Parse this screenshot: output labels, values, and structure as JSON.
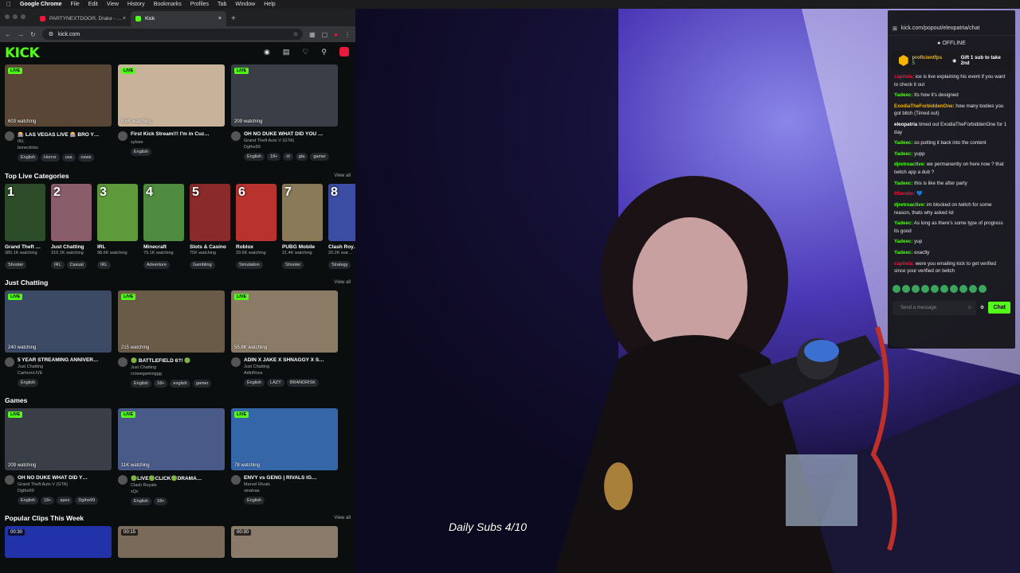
{
  "menubar": {
    "apple": "",
    "app": "Google Chrome",
    "items": [
      "File",
      "Edit",
      "View",
      "History",
      "Bookmarks",
      "Profiles",
      "Tab",
      "Window",
      "Help"
    ]
  },
  "tabs": [
    {
      "title": "PARTYNEXTDOOR, Drake - …",
      "active": false
    },
    {
      "title": "Kick",
      "active": true
    }
  ],
  "toolbar": {
    "url": "kick.com"
  },
  "kick": {
    "logo": "KICK"
  },
  "featured": [
    {
      "watching": "603 watching",
      "title": "🎰 LAS VEGAS LIVE 🎰 BRO Y…",
      "sub": "IRL",
      "channel": "boneclinks",
      "tags": [
        "English",
        "Horror",
        "usa",
        "news"
      ],
      "bg": "#5a4636"
    },
    {
      "watching": "5.6K watching",
      "title": "First Kick Stream!!! I'm in Cuz…",
      "sub": "",
      "channel": "sylvee",
      "tags": [
        "English"
      ],
      "bg": "#c9b29a"
    },
    {
      "watching": "209 watching",
      "title": "OH NO DUKE WHAT DID YOU …",
      "sub": "Grand Theft Auto V (GTA)",
      "channel": "Dgthe99",
      "tags": [
        "English",
        "18+",
        "irl",
        "gta",
        "gamer"
      ],
      "bg": "#3a3e46"
    }
  ],
  "categories_section": {
    "title": "Top Live Categories",
    "view_all": "View all"
  },
  "categories": [
    {
      "rank": "1",
      "name": "Grand Theft …",
      "viewers": "380.1K watching",
      "tag": "Shooter",
      "bg": "#2d4d2a"
    },
    {
      "rank": "2",
      "name": "Just Chatting",
      "viewers": "310.1K watching",
      "tag": "IRL",
      "tag2": "Casual",
      "bg": "#8a5d6a"
    },
    {
      "rank": "3",
      "name": "IRL",
      "viewers": "98.6K watching",
      "tag": "IRL",
      "bg": "#5d9a3a"
    },
    {
      "rank": "4",
      "name": "Minecraft",
      "viewers": "79.1K watching",
      "tag": "Adventure",
      "bg": "#4f8c3f"
    },
    {
      "rank": "5",
      "name": "Slots & Casino",
      "viewers": "75K watching",
      "tag": "Gambling",
      "bg": "#8a2a2a"
    },
    {
      "rank": "6",
      "name": "Roblox",
      "viewers": "29.6K watching",
      "tag": "Simulation",
      "bg": "#b8332e"
    },
    {
      "rank": "7",
      "name": "PUBG Mobile",
      "viewers": "21.4K watching",
      "tag": "Shooter",
      "bg": "#8a7a5a"
    },
    {
      "rank": "8",
      "name": "Clash Roy…",
      "viewers": "20.2K wat…",
      "tag": "Strategy",
      "bg": "#3b4da5"
    }
  ],
  "just_chatting_section": {
    "title": "Just Chatting",
    "view_all": "View all"
  },
  "just_chatting": [
    {
      "watching": "240 watching",
      "title": "5 YEAR STREAMING ANNIVER…",
      "sub": "Just Chatting",
      "channel": "CartoonLIVE",
      "tags": [
        "English"
      ],
      "bg": "#3c4a66"
    },
    {
      "watching": "215 watching",
      "title": "🟢 BATTLEFIELD 6?! 🟢",
      "sub": "Just Chatting",
      "channel": "crowegaminggg",
      "tags": [
        "English",
        "18+",
        "english",
        "gamer"
      ],
      "bg": "#6a5a48"
    },
    {
      "watching": "55.8K watching",
      "title": "ADIN X JAKE X SHNAGGY X S…",
      "sub": "Just Chatting",
      "channel": "AdinRoss",
      "tags": [
        "English",
        "LAZY",
        "BRANDRISK"
      ],
      "bg": "#8a7a66"
    }
  ],
  "games_section": {
    "title": "Games"
  },
  "games": [
    {
      "watching": "209 watching",
      "title": "OH NO DUKE WHAT DID Y…",
      "sub": "Grand Theft Auto V (GTA)",
      "channel": "Dgthe99",
      "tags": [
        "English",
        "18+",
        "apex",
        "Dgthe99"
      ],
      "bg": "#3a3e46"
    },
    {
      "watching": "11K watching",
      "title": "🟢LIVE🟢CLICK🟢DRAMA…",
      "sub": "Clash Royale",
      "channel": "xQc",
      "tags": [
        "English",
        "18+"
      ],
      "bg": "#4a5a88"
    },
    {
      "watching": "78 watching",
      "title": "ENVY vs GENG | RIVALS IG…",
      "sub": "Marvel Rivals",
      "channel": "sinatraa",
      "tags": [
        "English"
      ],
      "bg": "#3566a8"
    }
  ],
  "clips_section": {
    "title": "Popular Clips This Week",
    "view_all": "View all"
  },
  "clips": [
    {
      "duration": "00:30",
      "bg": "#2233aa"
    },
    {
      "duration": "00:15",
      "bg": "#7a6a5a"
    },
    {
      "duration": "00:30",
      "bg": "#8a7a6a"
    }
  ],
  "stream": {
    "caption": "Daily Subs 4/10"
  },
  "chat": {
    "url": "kick.com/popout/eleopatria/chat",
    "status": "OFFLINE",
    "pinned_user": "proficientfps",
    "pinned_count": "5",
    "pinned_text": "Gift 1 sub to take 2nd",
    "messages": [
      {
        "user": "capitela:",
        "color": "#e8193c",
        "text": "ice is live explaining his event if you want to check it out"
      },
      {
        "user": "Yadeec:",
        "color": "#53fc18",
        "text": "Its how it's designed"
      },
      {
        "user": "ExodiaTheForbiddenOne:",
        "color": "#f4b400",
        "text": "how many bodies you got bitch (Timed out)"
      },
      {
        "user": "eleopatria",
        "color": "#ffffff",
        "text": "timed out ExodiaTheForbiddenOne for 1 day"
      },
      {
        "user": "Yadeec:",
        "color": "#53fc18",
        "text": "so putting it back into the content"
      },
      {
        "user": "Yadeec:",
        "color": "#53fc18",
        "text": "yupp"
      },
      {
        "user": "djretroactive:",
        "color": "#53fc18",
        "text": "we permanently on here now ? that twitch app a dub ?"
      },
      {
        "user": "Yadeec:",
        "color": "#53fc18",
        "text": "this is like the after party"
      },
      {
        "user": "0Sender:",
        "color": "#e8193c",
        "text": "💙"
      },
      {
        "user": "djretroactive:",
        "color": "#53fc18",
        "text": "im blocked on twitch for some reason, thats why asked lol"
      },
      {
        "user": "Yadeec:",
        "color": "#53fc18",
        "text": "As long as there's some type of progress its good"
      },
      {
        "user": "Yadeec:",
        "color": "#53fc18",
        "text": "yup"
      },
      {
        "user": "Yadeec:",
        "color": "#53fc18",
        "text": "exactly"
      },
      {
        "user": "capitela:",
        "color": "#e8193c",
        "text": "were you emailing kick to get verified since your verified on twitch"
      }
    ],
    "send_placeholder": "Send a message",
    "chat_button": "Chat"
  }
}
